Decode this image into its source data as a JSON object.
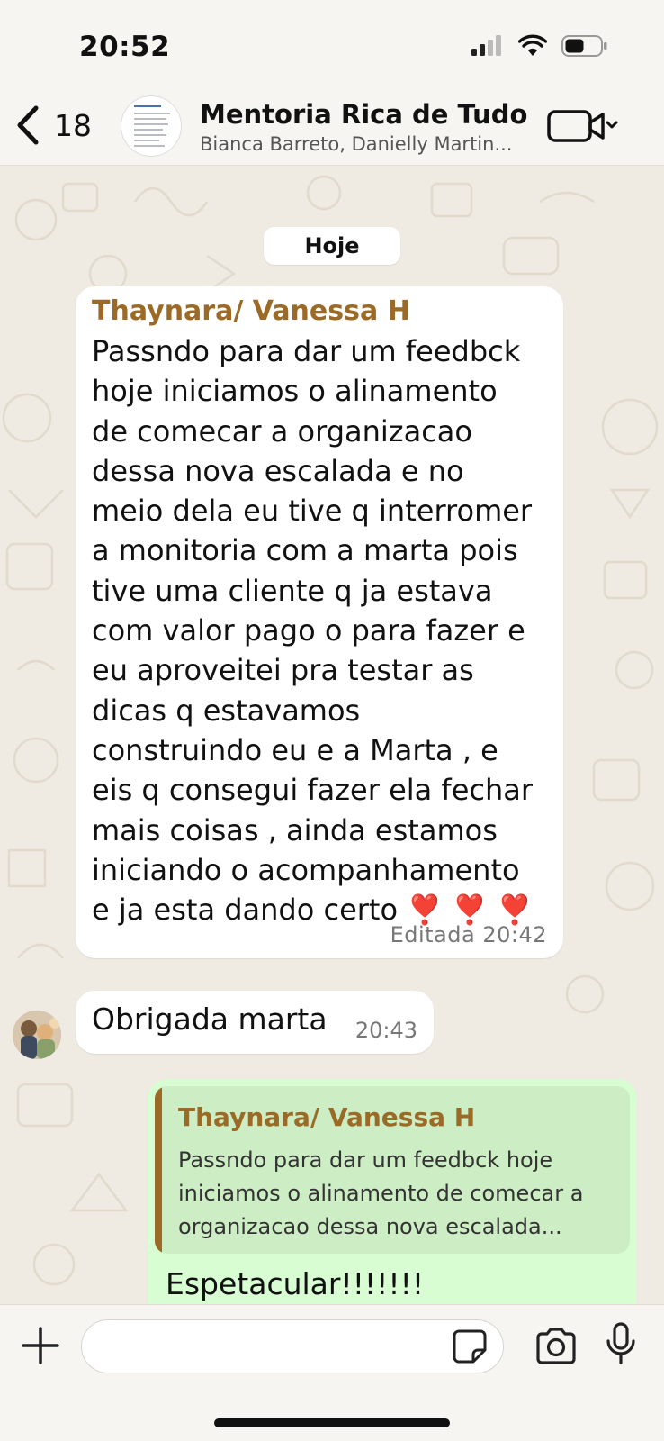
{
  "status_bar": {
    "time": "20:52"
  },
  "header": {
    "back_count": "18",
    "title": "Mentoria Rica de Tudo",
    "subtitle": "Bianca Barreto, Danielly Martin..."
  },
  "chat": {
    "date_chip": "Hoje",
    "messages": [
      {
        "sender": "Thaynara/ Vanessa H",
        "text": "Passndo para dar um feedbck\nhoje iniciamos o alinamento\nde comecar a organizacao\ndessa nova escalada e no\nmeio dela eu tive q interromer\na monitoria com a marta  pois\ntive uma cliente q ja estava\ncom valor pago o para fazer e\neu aproveitei pra testar as\ndicas q estavamos\nconstruindo eu e a Marta , e\neis q consegui fazer ela fechar\nmais coisas , ainda estamos\niniciando o acompanhamento\ne ja esta dando certo ❣️ ❣️ ❣️",
        "meta": "Editada 20:42"
      },
      {
        "text": "Obrigada marta",
        "time": "20:43"
      },
      {
        "quoted_sender": "Thaynara/ Vanessa H",
        "quoted_text": "Passndo para dar um feedbck hoje iniciamos o alinamento de comecar a organizacao dessa nova escalada...",
        "text": "Espetacular!!!!!!!"
      }
    ]
  },
  "colors": {
    "sender_name": "#9a6a26",
    "outgoing_bubble": "#d9fdd3",
    "incoming_bubble": "#ffffff",
    "chat_background": "#efeae2"
  },
  "composer": {
    "placeholder": ""
  }
}
